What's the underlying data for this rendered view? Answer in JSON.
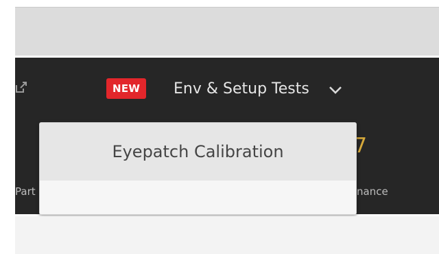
{
  "nav": {
    "badge": "NEW",
    "menu_label": "Env & Setup Tests",
    "external_icon": "external-link-icon",
    "chevron_icon": "chevron-down-icon",
    "left_cut_text": "Part",
    "right_cut_text": "nance"
  },
  "dropdown": {
    "items": [
      {
        "label": "Eyepatch Calibration"
      }
    ]
  },
  "colors": {
    "badge_red": "#e2262b",
    "nav_bg": "#262626",
    "accent_yellow": "#d6a93a"
  }
}
